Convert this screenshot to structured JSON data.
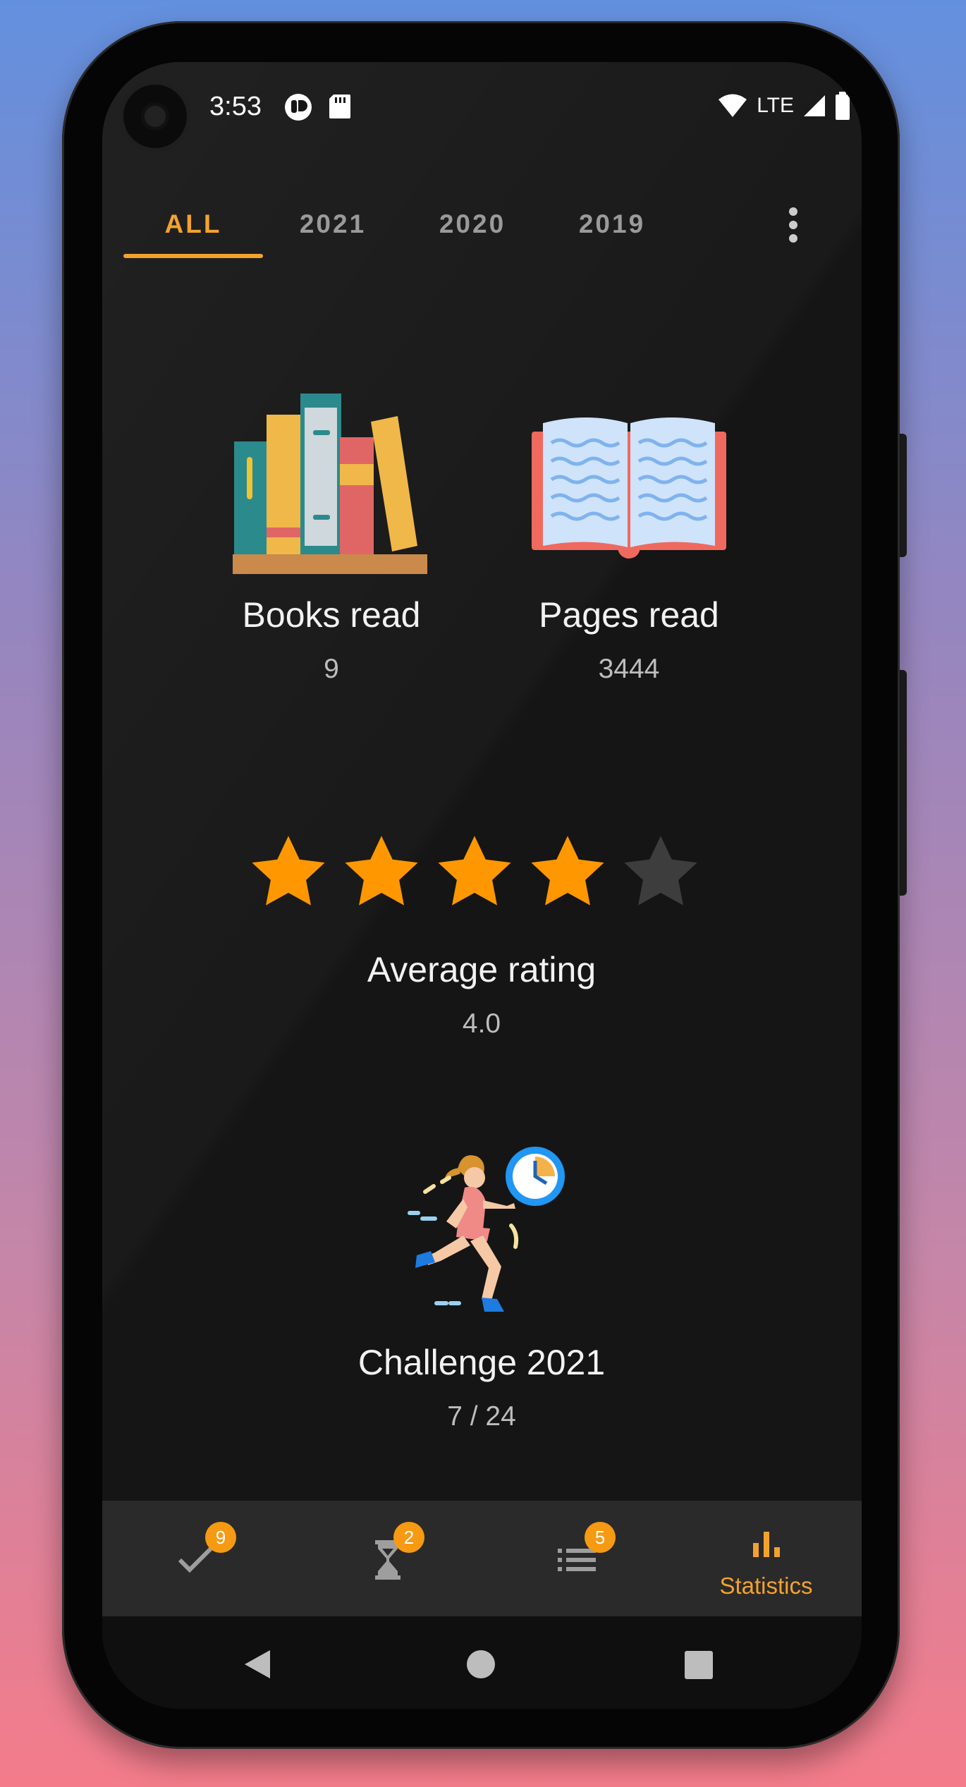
{
  "status_bar": {
    "time": "3:53",
    "network_label": "LTE",
    "icons": [
      "notification-app-icon",
      "sd-card-icon",
      "wifi-icon",
      "signal-icon",
      "battery-icon"
    ]
  },
  "tabs": [
    {
      "label": "ALL",
      "active": true
    },
    {
      "label": "2021",
      "active": false
    },
    {
      "label": "2020",
      "active": false
    },
    {
      "label": "2019",
      "active": false
    }
  ],
  "stats": {
    "books": {
      "label": "Books read",
      "value": "9",
      "icon": "bookshelf-icon"
    },
    "pages": {
      "label": "Pages read",
      "value": "3444",
      "icon": "open-book-icon"
    },
    "rating": {
      "label": "Average rating",
      "value": "4.0",
      "stars_filled": 4,
      "stars_total": 5
    },
    "challenge": {
      "label": "Challenge 2021",
      "value": "7 / 24",
      "icon": "runner-clock-icon"
    }
  },
  "bottom_nav": {
    "items": [
      {
        "icon": "check-icon",
        "badge": "9",
        "label": "",
        "active": false
      },
      {
        "icon": "hourglass-icon",
        "badge": "2",
        "label": "",
        "active": false
      },
      {
        "icon": "list-icon",
        "badge": "5",
        "label": "",
        "active": false
      },
      {
        "icon": "bar-chart-icon",
        "badge": "",
        "label": "Statistics",
        "active": true
      }
    ]
  },
  "colors": {
    "accent": "#f3a22e",
    "star_filled": "#ff9800",
    "star_empty": "#3d3d3d",
    "screen_bg": "#151515",
    "nav_bg": "#2a2a2a"
  }
}
